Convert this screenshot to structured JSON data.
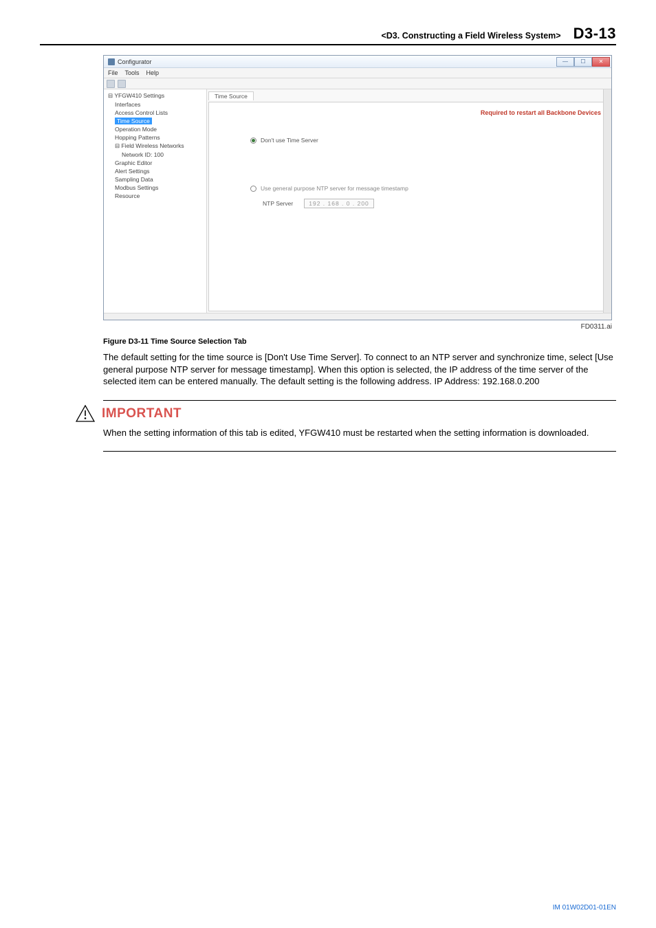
{
  "header": {
    "chapter_title": "<D3.  Constructing a Field Wireless System>",
    "page_number": "D3-13"
  },
  "screenshot": {
    "window_title": "Configurator",
    "menu": {
      "file": "File",
      "tools": "Tools",
      "help": "Help"
    },
    "tree": {
      "root": "YFGW410 Settings",
      "interfaces": "Interfaces",
      "access_control": "Access Control Lists",
      "time_source": "Time Source",
      "operation_mode": "Operation Mode",
      "hopping_patterns": "Hopping Patterns",
      "field_wireless": "Field Wireless Networks",
      "network_id": "Network ID: 100",
      "graphic_editor": "Graphic Editor",
      "alert_settings": "Alert Settings",
      "sampling_data": "Sampling Data",
      "modbus_settings": "Modbus Settings",
      "resource": "Resource"
    },
    "tab_label": "Time Source",
    "required_text": "Required to restart all Backbone Devices",
    "opt_dont_use": "Don't use Time Server",
    "opt_use_ntp": "Use general purpose NTP server for message timestamp",
    "ntp_label": "NTP Server",
    "ntp_ip": "192 . 168 .  0  . 200"
  },
  "image_id": "FD0311.ai",
  "figure_caption": "Figure D3-11  Time Source Selection Tab",
  "body_para": "The default setting for the time source is [Don't Use Time Server]. To connect to an NTP server and synchronize time, select [Use general purpose NTP server for message timestamp]. When this option is selected, the IP address of the time server of the selected item can be entered manually. The default setting is the following address. IP Address: 192.168.0.200",
  "important": {
    "label": "IMPORTANT",
    "text": "When the setting information of this tab is edited, YFGW410 must be restarted when the setting information is downloaded."
  },
  "footer": "IM 01W02D01-01EN"
}
